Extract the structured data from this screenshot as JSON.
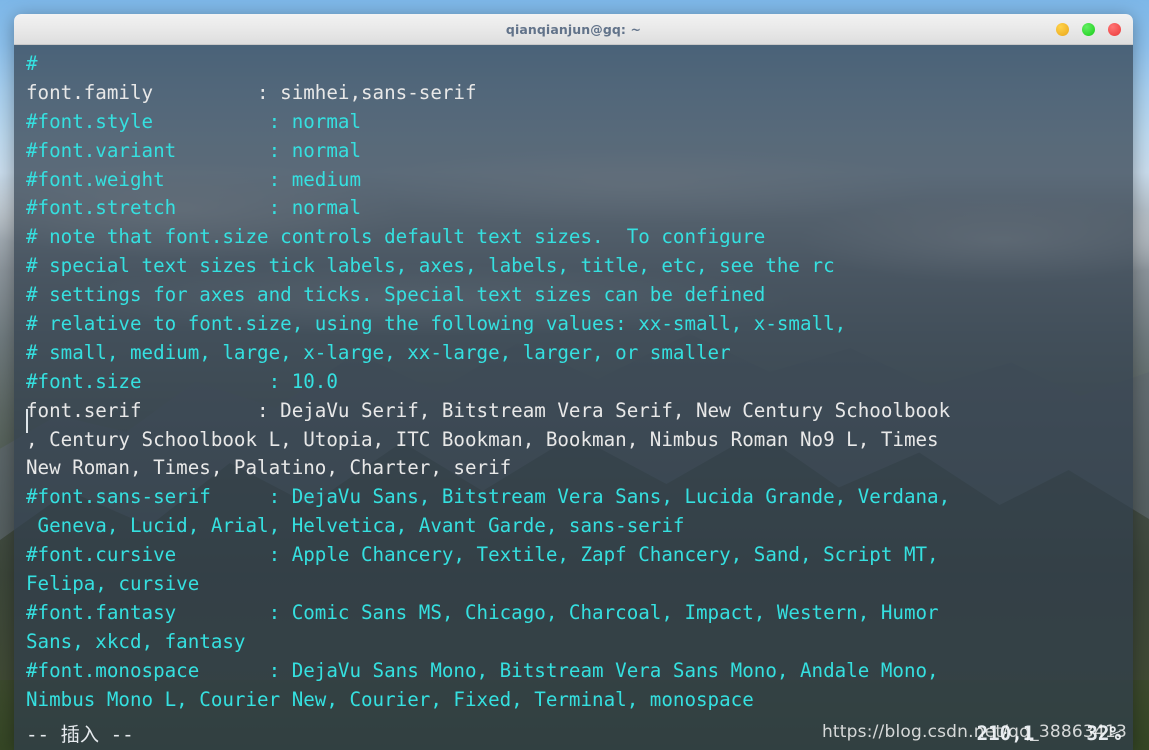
{
  "window": {
    "title": "qianqianjun@gq: ~",
    "controls": [
      {
        "name": "minimize",
        "color": "#f0b429"
      },
      {
        "name": "maximize",
        "color": "#2fd72f"
      },
      {
        "name": "close",
        "color": "#f14b4b"
      }
    ]
  },
  "colors": {
    "comment": "#35e0e0",
    "text": "#e8e8e8",
    "terminal_bg": "rgba(48,62,76,0.72)",
    "titlebar_bg": "#e8e8e8",
    "title_fg": "#62738a"
  },
  "terminal": {
    "lines": [
      {
        "text": "#",
        "style": "comment"
      },
      {
        "text": "font.family         : simhei,sans-serif",
        "style": "text"
      },
      {
        "text": "#font.style          : normal",
        "style": "comment"
      },
      {
        "text": "#font.variant        : normal",
        "style": "comment"
      },
      {
        "text": "#font.weight         : medium",
        "style": "comment"
      },
      {
        "text": "#font.stretch        : normal",
        "style": "comment"
      },
      {
        "text": "# note that font.size controls default text sizes.  To configure",
        "style": "comment"
      },
      {
        "text": "# special text sizes tick labels, axes, labels, title, etc, see the rc",
        "style": "comment"
      },
      {
        "text": "# settings for axes and ticks. Special text sizes can be defined",
        "style": "comment"
      },
      {
        "text": "# relative to font.size, using the following values: xx-small, x-small,",
        "style": "comment"
      },
      {
        "text": "# small, medium, large, x-large, xx-large, larger, or smaller",
        "style": "comment"
      },
      {
        "text": "#font.size           : 10.0",
        "style": "comment"
      },
      {
        "text": "font.serif          : DejaVu Serif, Bitstream Vera Serif, New Century Schoolbook",
        "style": "text"
      },
      {
        "text": ", Century Schoolbook L, Utopia, ITC Bookman, Bookman, Nimbus Roman No9 L, Times",
        "style": "text"
      },
      {
        "text": "New Roman, Times, Palatino, Charter, serif",
        "style": "text"
      },
      {
        "text": "#font.sans-serif     : DejaVu Sans, Bitstream Vera Sans, Lucida Grande, Verdana,",
        "style": "comment"
      },
      {
        "text": " Geneva, Lucid, Arial, Helvetica, Avant Garde, sans-serif",
        "style": "comment"
      },
      {
        "text": "#font.cursive        : Apple Chancery, Textile, Zapf Chancery, Sand, Script MT,",
        "style": "comment"
      },
      {
        "text": "Felipa, cursive",
        "style": "comment"
      },
      {
        "text": "#font.fantasy        : Comic Sans MS, Chicago, Charcoal, Impact, Western, Humor",
        "style": "comment"
      },
      {
        "text": "Sans, xkcd, fantasy",
        "style": "comment"
      },
      {
        "text": "#font.monospace      : DejaVu Sans Mono, Bitstream Vera Sans Mono, Andale Mono,",
        "style": "comment"
      },
      {
        "text": "Nimbus Mono L, Courier New, Courier, Fixed, Terminal, monospace",
        "style": "comment"
      }
    ]
  },
  "statusline": {
    "mode": "-- 插入 --",
    "position": "210,1",
    "percent": "32%"
  },
  "watermark": "https://blog.csdn.net/qq_38863413"
}
